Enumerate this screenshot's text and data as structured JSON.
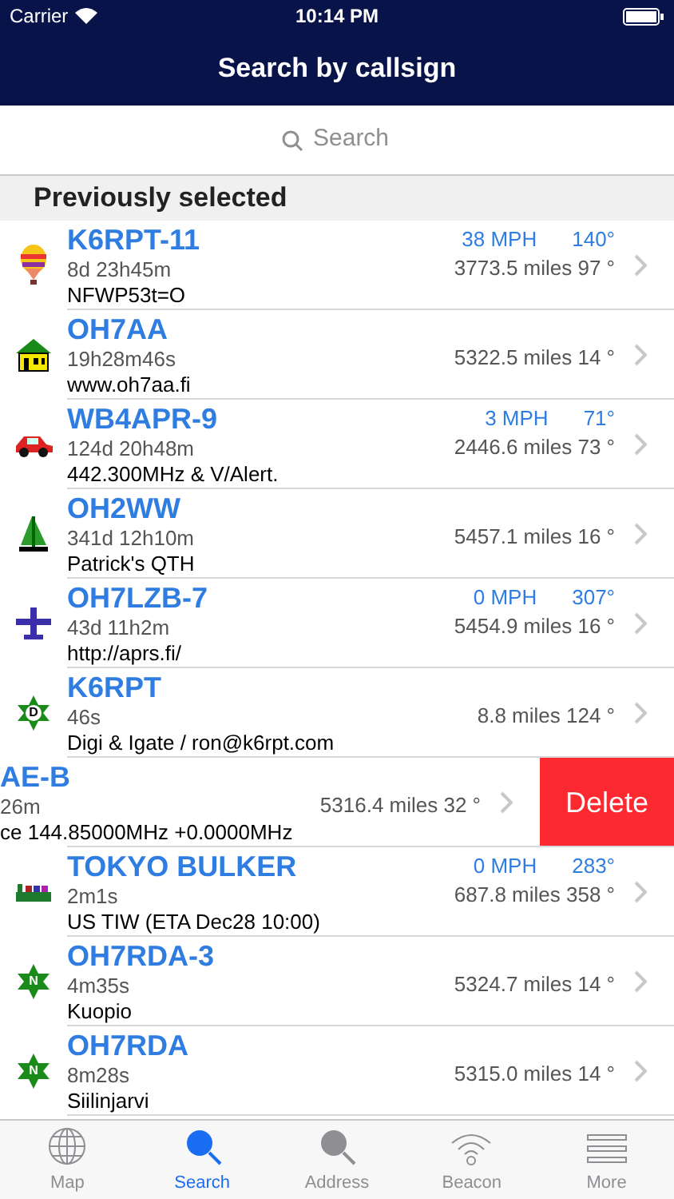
{
  "status_bar": {
    "carrier": "Carrier",
    "time": "10:14 PM"
  },
  "nav": {
    "title": "Search by callsign"
  },
  "search": {
    "placeholder": "Search"
  },
  "section": {
    "title": "Previously selected"
  },
  "rows": [
    {
      "kind": "balloon",
      "callsign": "K6RPT-11",
      "age": "8d 23h45m",
      "comment": "NFWP53t=O",
      "speed": "38 MPH",
      "course": "140°",
      "distance": "3773.5 miles 97 °"
    },
    {
      "kind": "house",
      "callsign": "OH7AA",
      "age": "19h28m46s",
      "comment": "www.oh7aa.fi",
      "distance": "5322.5 miles 14 °"
    },
    {
      "kind": "car",
      "callsign": "WB4APR-9",
      "age": "124d 20h48m",
      "comment": "442.300MHz & V/Alert.",
      "speed": "3 MPH",
      "course": "71°",
      "distance": "2446.6 miles 73 °"
    },
    {
      "kind": "sailboat",
      "callsign": "OH2WW",
      "age": "341d 12h10m",
      "comment": "Patrick's QTH",
      "distance": "5457.1 miles 16 °"
    },
    {
      "kind": "plane",
      "callsign": "OH7LZB-7",
      "age": "43d 11h2m",
      "comment": "http://aprs.fi/",
      "speed": "0 MPH",
      "course": "307°",
      "distance": "5454.9 miles 16 °"
    },
    {
      "kind": "star",
      "overlay": "D",
      "callsign": "K6RPT",
      "age": "46s",
      "comment": "Digi & Igate / ron@k6rpt.com",
      "distance": "8.8 miles 124 °"
    },
    {
      "kind": "swiped",
      "callsign": "AE-B",
      "age": "26m",
      "comment": "ce 144.85000MHz +0.0000MHz",
      "distance": "5316.4 miles 32 °",
      "action": "Delete"
    },
    {
      "kind": "ship",
      "callsign": "TOKYO BULKER",
      "age": "2m1s",
      "comment": "US TIW (ETA Dec28 10:00)",
      "speed": "0 MPH",
      "course": "283°",
      "distance": "687.8 miles 358 °"
    },
    {
      "kind": "star",
      "overlay": "N",
      "callsign": "OH7RDA-3",
      "age": "4m35s",
      "comment": "Kuopio",
      "distance": "5324.7 miles 14 °"
    },
    {
      "kind": "star",
      "overlay": "N",
      "callsign": "OH7RDA",
      "age": "8m28s",
      "comment": "Siilinjarvi",
      "distance": "5315.0 miles 14 °"
    }
  ],
  "tabs": [
    {
      "kind": "globe",
      "label": "Map",
      "selected": false
    },
    {
      "kind": "search",
      "label": "Search",
      "selected": true
    },
    {
      "kind": "search",
      "label": "Address",
      "selected": false
    },
    {
      "kind": "wifi",
      "label": "Beacon",
      "selected": false
    },
    {
      "kind": "lines",
      "label": "More",
      "selected": false
    }
  ]
}
